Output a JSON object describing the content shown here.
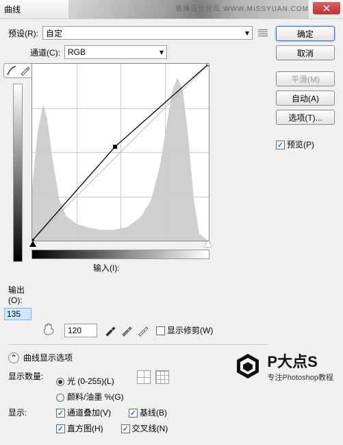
{
  "title": "曲线",
  "watermark": "思缘设计论坛  WWW.MISSYUAN.COM",
  "preset": {
    "label": "预设(R):",
    "value": "自定"
  },
  "channel": {
    "label": "通道(C):",
    "value": "RGB"
  },
  "output": {
    "label": "输出(O):",
    "value": "135"
  },
  "input": {
    "label": "输入(I):",
    "value": "120"
  },
  "showclip_label": "显示修剪(W)",
  "buttons": {
    "ok": "确定",
    "cancel": "取消",
    "smooth": "平滑(M)",
    "auto": "自动(A)",
    "options": "选项(T)..."
  },
  "preview_label": "预览(P)",
  "section_head": "曲线显示选项",
  "show_amount": {
    "label": "显示数量:",
    "opt1": "光 (0-255)(L)",
    "opt2": "颜料/油墨 %(G)"
  },
  "show": {
    "label": "显示:",
    "overlay": "通道叠加(V)",
    "baseline": "基线(B)",
    "hist": "直方图(H)",
    "cross": "交叉线(N)"
  },
  "logo": {
    "text1": "P大点S",
    "text2": "专注Photoshop教程"
  },
  "chart_data": {
    "type": "line",
    "title": "曲线",
    "xlabel": "输入",
    "ylabel": "输出",
    "xlim": [
      0,
      255
    ],
    "ylim": [
      0,
      255
    ],
    "series": [
      {
        "name": "baseline",
        "x": [
          0,
          255
        ],
        "y": [
          0,
          255
        ]
      },
      {
        "name": "curve",
        "x": [
          0,
          120,
          255
        ],
        "y": [
          0,
          135,
          255
        ]
      }
    ],
    "points": [
      {
        "x": 0,
        "y": 0
      },
      {
        "x": 120,
        "y": 135
      },
      {
        "x": 255,
        "y": 255
      }
    ],
    "histogram_x_range": [
      0,
      255
    ]
  }
}
